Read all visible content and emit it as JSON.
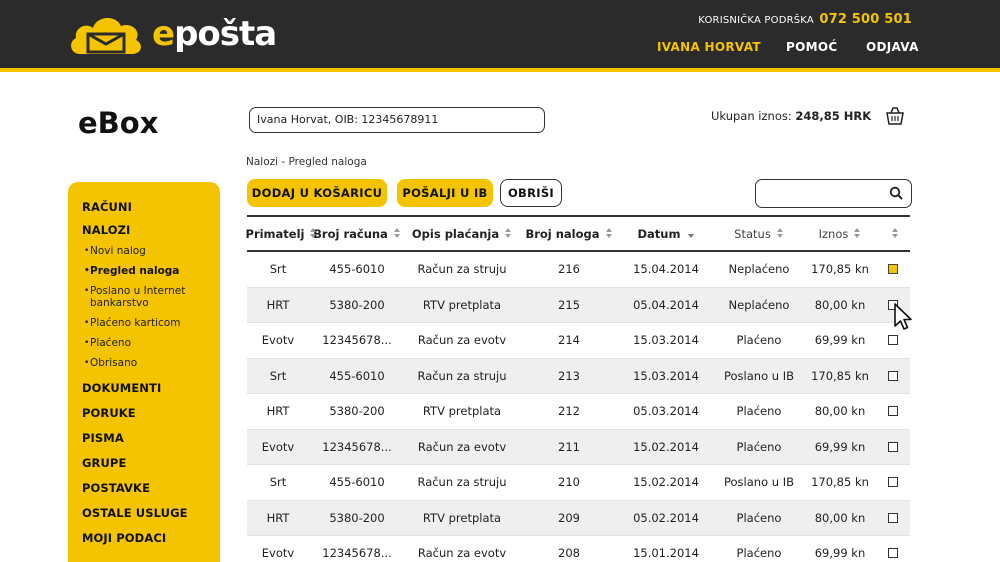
{
  "header": {
    "logo_text_accent": "e",
    "logo_text_rest": "pošta",
    "support_label": "KORISNIČKA PODRŠKA",
    "support_phone": "072 500 501",
    "nav": {
      "user": "IVANA HORVAT",
      "help": "POMOĆ",
      "logout": "ODJAVA"
    }
  },
  "page_title": "eBox",
  "client_field": {
    "value": "Ivana Horvat, OIB: 12345678911"
  },
  "total": {
    "label": "Ukupan iznos:",
    "value": "248,85 HRK"
  },
  "breadcrumb": "Nalozi - Pregled naloga",
  "toolbar": {
    "add_label": "DODAJ U KOŠARICU",
    "send_label": "POŠALJI U IB",
    "delete_label": "OBRIŠI"
  },
  "search": {
    "placeholder": ""
  },
  "sidebar": {
    "items": [
      {
        "label": "RAČUNI"
      },
      {
        "label": "NALOZI"
      },
      {
        "label": "DOKUMENTI"
      },
      {
        "label": "PORUKE"
      },
      {
        "label": "PISMA"
      },
      {
        "label": "GRUPE"
      },
      {
        "label": "POSTAVKE"
      },
      {
        "label": "OSTALE USLUGE"
      },
      {
        "label": "MOJI PODACI"
      }
    ],
    "subitems": [
      {
        "label": "Novi nalog"
      },
      {
        "label": "Pregled naloga"
      },
      {
        "label": "Poslano u Internet bankarstvo"
      },
      {
        "label": "Plaćeno karticom"
      },
      {
        "label": "Plaćeno"
      },
      {
        "label": "Obrisano"
      }
    ]
  },
  "table": {
    "headers": [
      "Primatelj",
      "Broj računa",
      "Opis plaćanja",
      "Broj naloga",
      "Datum",
      "Status",
      "Iznos"
    ],
    "rows": [
      [
        "Srt",
        "455-6010",
        "Račun za struju",
        "216",
        "15.04.2014",
        "Neplaćeno",
        "170,85 kn"
      ],
      [
        "HRT",
        "5380-200",
        "RTV pretplata",
        "215",
        "05.04.2014",
        "Neplaćeno",
        "80,00 kn"
      ],
      [
        "Evotv",
        "12345678...",
        "Račun za evotv",
        "214",
        "15.03.2014",
        "Plaćeno",
        "69,99 kn"
      ],
      [
        "Srt",
        "455-6010",
        "Račun za struju",
        "213",
        "15.03.2014",
        "Poslano u IB",
        "170,85 kn"
      ],
      [
        "HRT",
        "5380-200",
        "RTV pretplata",
        "212",
        "05.03.2014",
        "Plaćeno",
        "80,00 kn"
      ],
      [
        "Evotv",
        "12345678...",
        "Račun za evotv",
        "211",
        "15.02.2014",
        "Plaćeno",
        "69,99 kn"
      ],
      [
        "Srt",
        "455-6010",
        "Račun za struju",
        "210",
        "15.02.2014",
        "Poslano u IB",
        "170,85 kn"
      ],
      [
        "HRT",
        "5380-200",
        "RTV pretplata",
        "209",
        "05.02.2014",
        "Plaćeno",
        "80,00 kn"
      ],
      [
        "Evotv",
        "12345678...",
        "Račun za evotv",
        "208",
        "15.01.2014",
        "Plaćeno",
        "69,99 kn"
      ]
    ],
    "checked": [
      true,
      false,
      false,
      false,
      false,
      false,
      false,
      false,
      false
    ]
  },
  "colors": {
    "accent": "#f5c400",
    "header_bg": "#2b2b2b",
    "row_alt": "#efefef"
  },
  "icons": [
    "logo-cloud-envelope-icon",
    "cart-icon",
    "search-icon",
    "sort-icon",
    "mouse-pointer-icon"
  ]
}
